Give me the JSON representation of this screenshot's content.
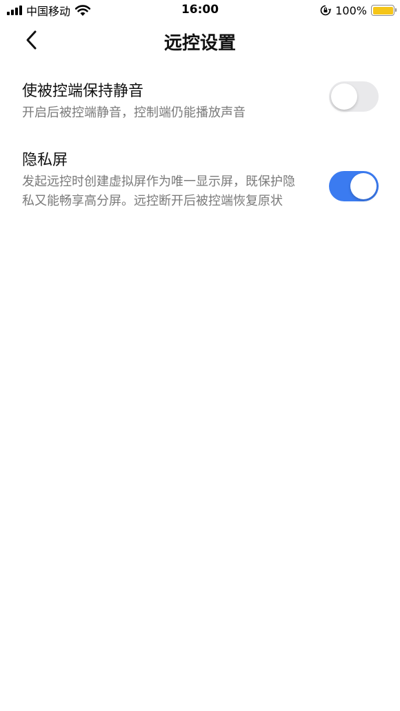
{
  "status_bar": {
    "carrier": "中国移动",
    "time": "16:00",
    "battery_percent": "100%",
    "battery_color": "#f5c518",
    "icons": [
      "signal-icon",
      "wifi-icon",
      "rotation-lock-icon",
      "battery-icon"
    ]
  },
  "nav": {
    "back_icon": "chevron-left-icon",
    "title": "远控设置"
  },
  "settings": [
    {
      "title": "使被控端保持静音",
      "description": "开启后被控端静音，控制端仍能播放声音",
      "enabled": false
    },
    {
      "title": "隐私屏",
      "description": "发起远控时创建虚拟屏作为唯一显示屏，既保护隐私又能畅享高分屏。远控断开后被控端恢复原状",
      "enabled": true
    }
  ],
  "colors": {
    "toggle_on": "#3b7bf0",
    "toggle_off": "#e9e9eb"
  }
}
